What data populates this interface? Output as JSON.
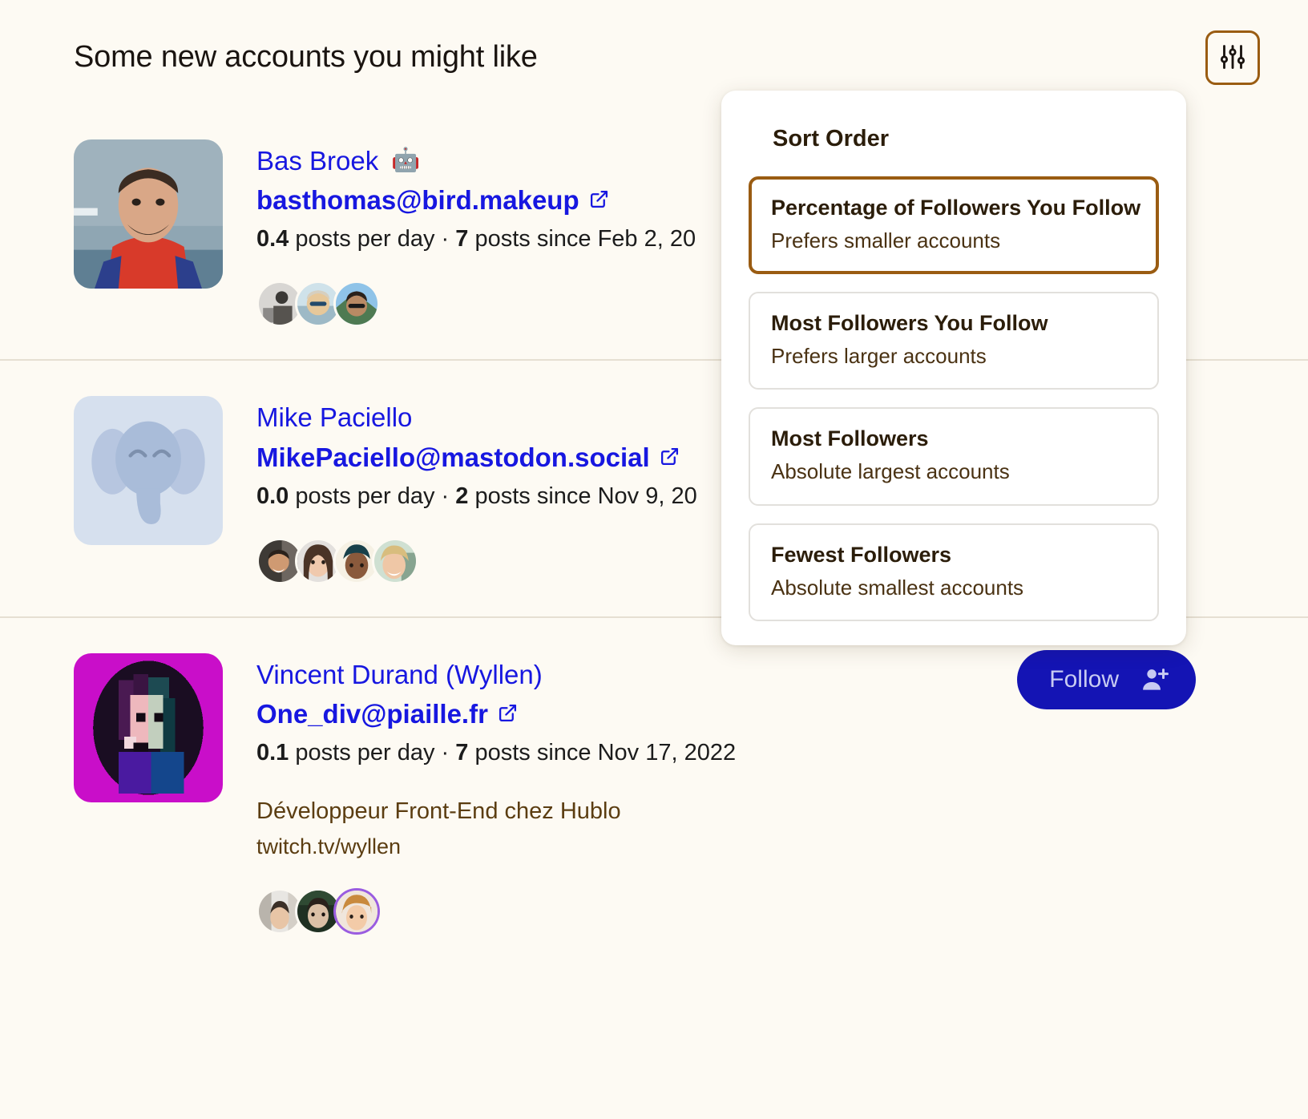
{
  "header": {
    "title": "Some new accounts you might like",
    "filter_icon": "sliders-icon",
    "accent_color": "#9a5c12"
  },
  "accounts": [
    {
      "display_name": "Bas Broek",
      "bot_badge": "🤖",
      "handle": "basthomas@bird.makeup",
      "external_link_icon": "external-link-icon",
      "posts_per_day": "0.4",
      "stats_mid": " posts per day · ",
      "posts_count": "7",
      "stats_tail": " posts since Feb 2, 20",
      "follower_count": 3,
      "avatar_kind": "photo-man-red-jacket"
    },
    {
      "display_name": "Mike Paciello",
      "bot_badge": "",
      "handle": "MikePaciello@mastodon.social",
      "external_link_icon": "external-link-icon",
      "posts_per_day": "0.0",
      "stats_mid": " posts per day · ",
      "posts_count": "2",
      "stats_tail": " posts since Nov 9, 20",
      "follower_count": 4,
      "avatar_kind": "mastodon-elephant"
    },
    {
      "display_name": "Vincent Durand (Wyllen)",
      "bot_badge": "",
      "handle": "One_div@piaille.fr",
      "external_link_icon": "external-link-icon",
      "posts_per_day": "0.1",
      "stats_mid": " posts per day · ",
      "posts_count": "7",
      "stats_tail": " posts since Nov 17, 2022",
      "bio": "Développeur Front-End chez Hublo",
      "bio_link": "twitch.tv/wyllen",
      "follow_label": "Follow",
      "follow_icon": "person-add-icon",
      "follower_count": 3,
      "avatar_kind": "pixel-art-magenta"
    }
  ],
  "sort_panel": {
    "title": "Sort Order",
    "options": [
      {
        "label": "Percentage of Followers You Follow",
        "desc": "Prefers smaller accounts",
        "selected": true
      },
      {
        "label": "Most Followers You Follow",
        "desc": "Prefers larger accounts",
        "selected": false
      },
      {
        "label": "Most Followers",
        "desc": "Absolute largest accounts",
        "selected": false
      },
      {
        "label": "Fewest Followers",
        "desc": "Absolute smallest accounts",
        "selected": false
      }
    ]
  }
}
